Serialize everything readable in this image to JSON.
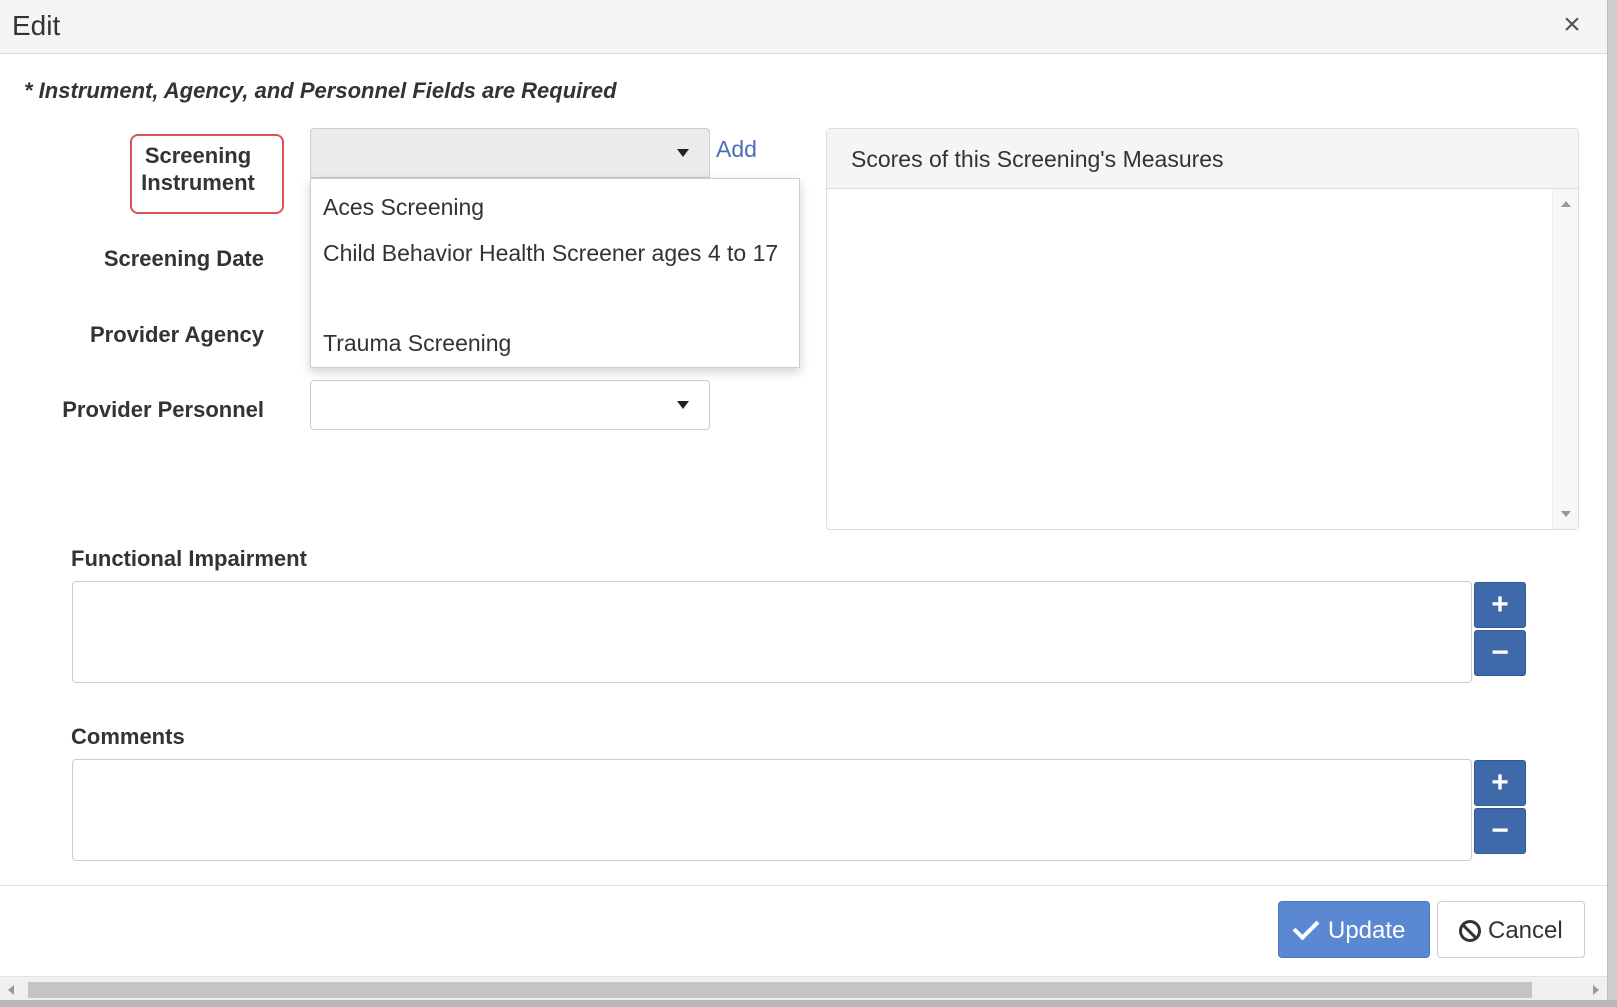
{
  "dialog": {
    "title": "Edit",
    "close_glyph": "×"
  },
  "form": {
    "required_note": "* Instrument, Agency, and Personnel Fields are Required",
    "screening_instrument_label": "Screening Instrument",
    "screening_date_label": "Screening Date",
    "provider_agency_label": "Provider Agency",
    "provider_personnel_label": "Provider Personnel",
    "add_link": "Add",
    "instrument_selected": "",
    "personnel_selected": ""
  },
  "instrument_options": [
    "Aces Screening",
    "Child Behavior Health Screener ages 4 to 17",
    "Trauma Screening"
  ],
  "scores_panel": {
    "title": "Scores of this Screening's Measures"
  },
  "functional_impairment": {
    "label": "Functional Impairment",
    "add_glyph": "+",
    "remove_glyph": "−"
  },
  "comments": {
    "label": "Comments",
    "add_glyph": "+",
    "remove_glyph": "−"
  },
  "footer": {
    "update_label": "Update",
    "cancel_label": "Cancel"
  },
  "colors": {
    "primary": "#5b88d3",
    "square_button": "#3e6aa9",
    "highlight_border": "#d9534f",
    "link": "#4a6fb5"
  },
  "icons": {
    "update": "check-icon",
    "cancel": "ban-icon",
    "dropdown": "caret-down-icon"
  }
}
